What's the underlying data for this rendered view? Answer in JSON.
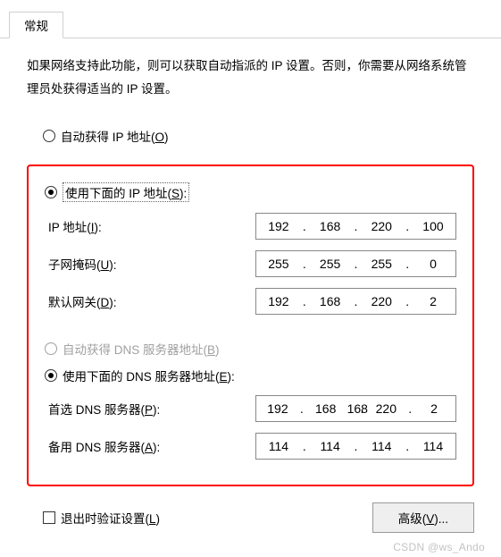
{
  "tab": {
    "label": "常规"
  },
  "description": "如果网络支持此功能，则可以获取自动指派的 IP 设置。否则，你需要从网络系统管理员处获得适当的 IP 设置。",
  "ip_section": {
    "auto_label_pre": "自动获得 IP 地址(",
    "auto_key": "O",
    "auto_label_post": ")",
    "manual_label_pre": "使用下面的 IP 地址(",
    "manual_key": "S",
    "manual_label_post": "):",
    "ip_label_pre": "IP 地址(",
    "ip_key": "I",
    "ip_label_post": "):",
    "ip_value": {
      "o1": "192",
      "o2": "168",
      "o3": "220",
      "o4": "100"
    },
    "mask_label_pre": "子网掩码(",
    "mask_key": "U",
    "mask_label_post": "):",
    "mask_value": {
      "o1": "255",
      "o2": "255",
      "o3": "255",
      "o4": "0"
    },
    "gw_label_pre": "默认网关(",
    "gw_key": "D",
    "gw_label_post": "):",
    "gw_value": {
      "o1": "192",
      "o2": "168",
      "o3": "220",
      "o4": "2"
    }
  },
  "dns_section": {
    "auto_label_pre": "自动获得 DNS 服务器地址(",
    "auto_key": "B",
    "auto_label_post": ")",
    "manual_label_pre": "使用下面的 DNS 服务器地址(",
    "manual_key": "E",
    "manual_label_post": "):",
    "pref_label_pre": "首选 DNS 服务器(",
    "pref_key": "P",
    "pref_label_post": "):",
    "pref_value": {
      "o1": "192",
      "o2": "168",
      "o3": "220",
      "o4": "2"
    },
    "alt_label_pre": "备用 DNS 服务器(",
    "alt_key": "A",
    "alt_label_post": "):",
    "alt_value": {
      "o1": "114",
      "o2": "114",
      "o3": "114",
      "o4": "114"
    }
  },
  "footer": {
    "validate_label_pre": "退出时验证设置(",
    "validate_key": "L",
    "validate_label_post": ")",
    "advanced_label_pre": "高级(",
    "advanced_key": "V",
    "advanced_label_post": ")..."
  },
  "dot": ".",
  "watermark": "CSDN @ws_Ando"
}
